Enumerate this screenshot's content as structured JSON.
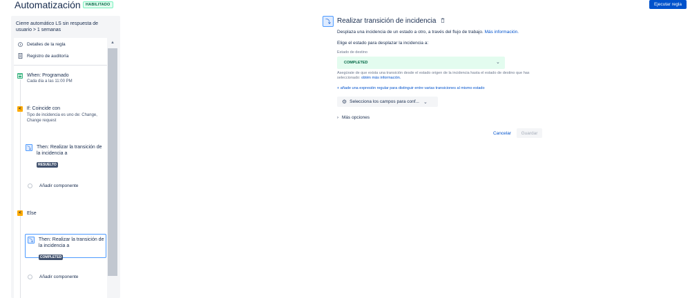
{
  "header": {
    "title": "Automatización",
    "status_badge": "HABILITADO",
    "run_button": "Ejecutar regla"
  },
  "sidebar": {
    "rule_name": "Cierre automático LS sin respuesta de usuario > 1 semanas",
    "rule_details": "Detalles de la regla",
    "audit_log": "Registro de auditoría",
    "trigger": {
      "title": "When: Programado",
      "desc": "Cada día a las 11:00 PM"
    },
    "condition": {
      "title": "If: Coincide con",
      "desc": "Tipo de incidencia es uno de: Change, Change request"
    },
    "then1": {
      "title": "Then: Realizar la transición de la incidencia a",
      "badge": "RESUELTO"
    },
    "add_component_1": "Añadir componente",
    "else": "Else",
    "then2": {
      "title": "Then: Realizar la transición de la incidencia a",
      "badge": "COMPLETED"
    },
    "add_component_2": "Añadir componente"
  },
  "main": {
    "title": "Realizar transición de incidencia",
    "desc": "Desplaza una incidencia de un estado a otro, a través del flujo de trabajo.",
    "more_info": "Más información.",
    "choose_label": "Elige el estado para desplazar la incidencia a:",
    "dest_label": "Estado de destino",
    "dest_value": "COMPLETED",
    "hint": "Asegúrate de que exista una transición desde el estado origen de la incidencia hasta el estado de destino que has seleccionado:",
    "hint_link": "obtén más información.",
    "regex_link": "+ añade una expresión regular para distinguir entre varias transiciones al mismo estado",
    "fields_button": "Selecciona los campos para conf...",
    "more_options": "Más opciones",
    "cancel": "Cancelar",
    "save": "Guardar"
  },
  "icons": {
    "accent": "#0052cc",
    "success": "#36b37e",
    "warning": "#ffab00"
  }
}
